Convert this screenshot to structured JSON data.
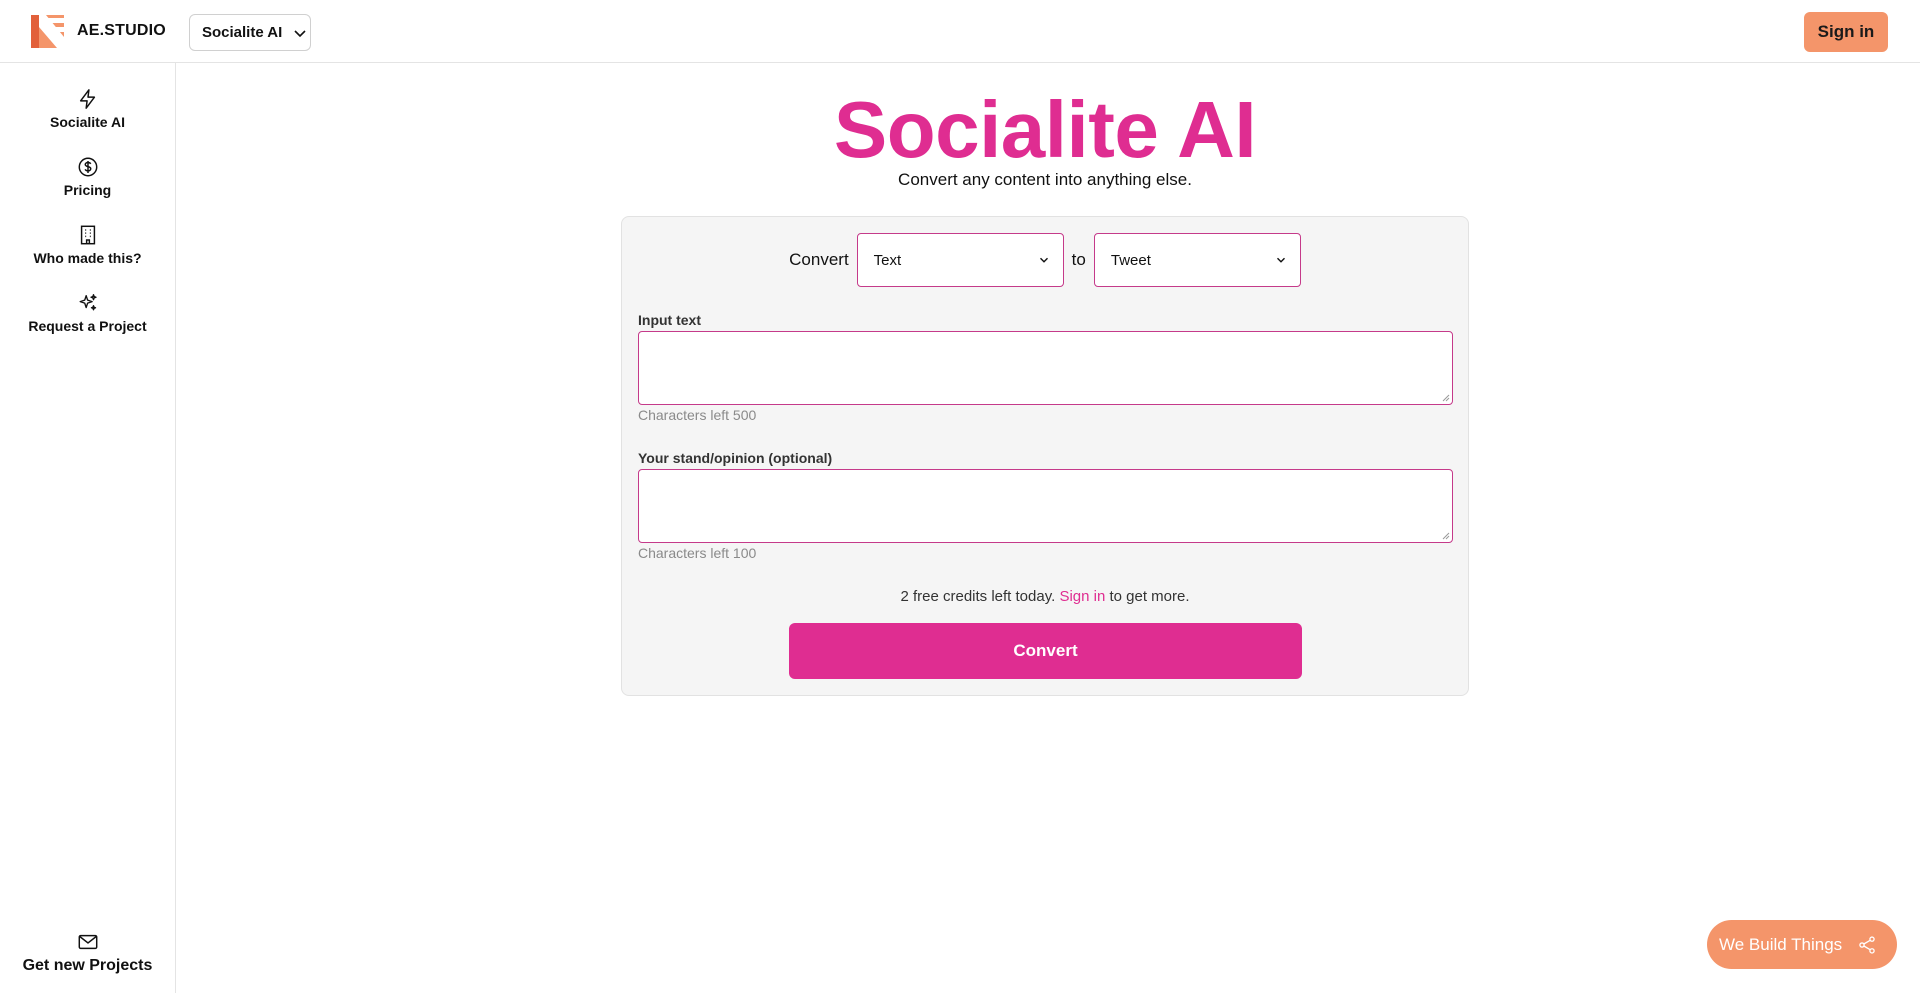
{
  "header": {
    "brand": "AE.STUDIO",
    "app_switcher": "Socialite AI",
    "sign_in": "Sign in"
  },
  "sidebar": {
    "items": [
      {
        "label": "Socialite AI",
        "icon": "lightning-icon"
      },
      {
        "label": "Pricing",
        "icon": "dollar-icon"
      },
      {
        "label": "Who made this?",
        "icon": "building-icon"
      },
      {
        "label": "Request a Project",
        "icon": "sparkles-icon"
      }
    ],
    "bottom": {
      "label": "Get new Projects",
      "icon": "mail-icon"
    }
  },
  "main": {
    "title": "Socialite AI",
    "subtitle": "Convert any content into anything else.",
    "convert_label": "Convert",
    "to_label": "to",
    "from_select": "Text",
    "to_select": "Tweet",
    "input_label": "Input text",
    "input_value": "",
    "input_helper": "Characters left 500",
    "stand_label": "Your stand/opinion (optional)",
    "stand_value": "",
    "stand_helper": "Characters left 100",
    "credits_count": "2",
    "credits_text": " free credits left today. ",
    "credits_link": "Sign in",
    "credits_tail": " to get more.",
    "convert_button": "Convert"
  },
  "fab": {
    "label": "We Build Things",
    "icon": "share-icon"
  },
  "colors": {
    "accent": "#df2d91",
    "orange": "#f4956a"
  }
}
